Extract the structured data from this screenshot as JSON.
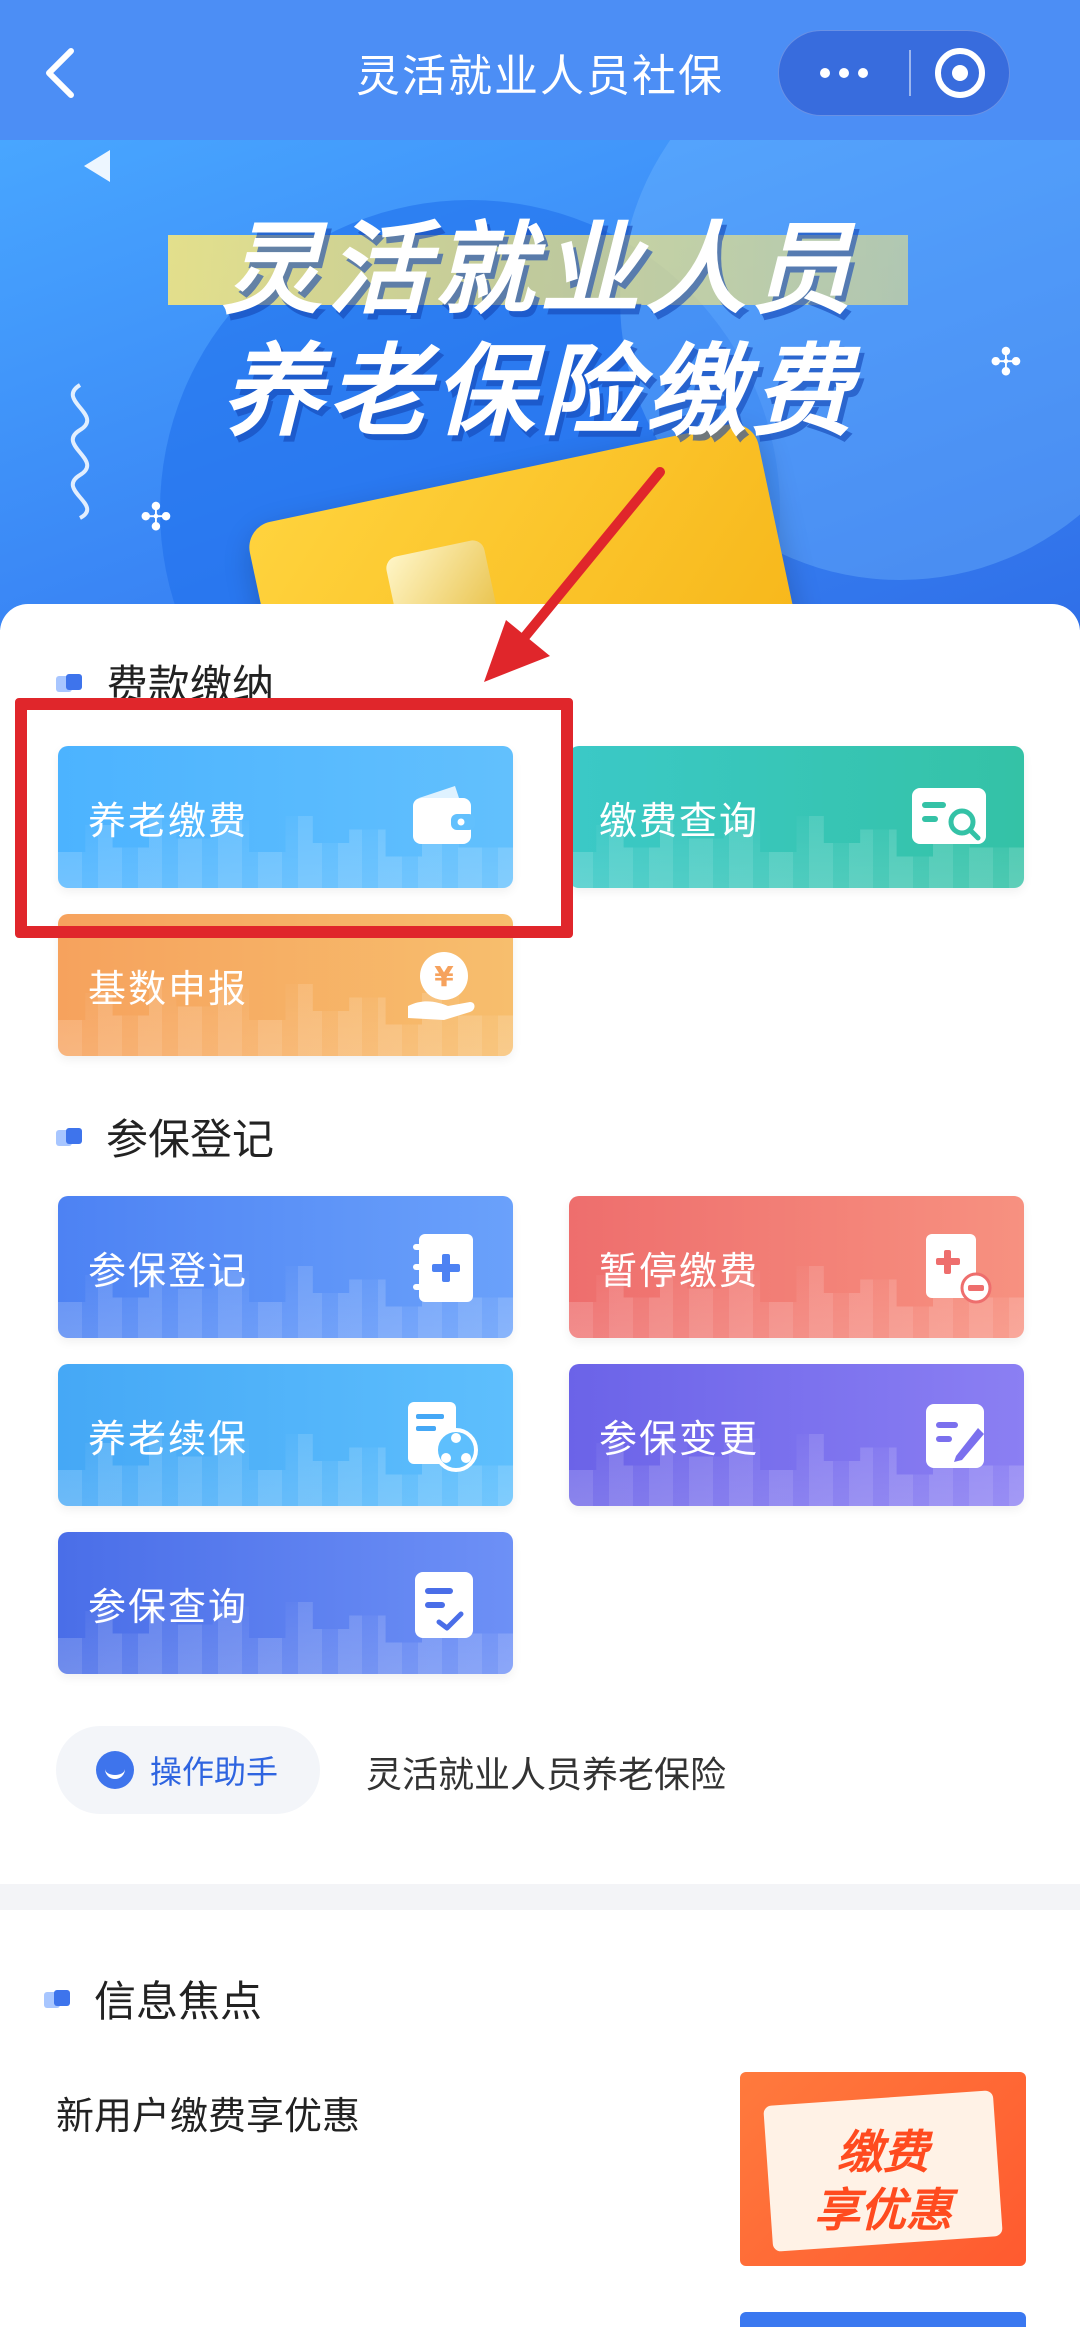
{
  "nav": {
    "title": "灵活就业人员社保"
  },
  "banner": {
    "line1": "灵活就业人员",
    "line2": "养老保险缴费"
  },
  "sections": {
    "payment": {
      "title": "费款缴纳",
      "tiles": [
        {
          "label": "养老缴费",
          "icon": "wallet-icon"
        },
        {
          "label": "缴费查询",
          "icon": "search-card-icon"
        },
        {
          "label": "基数申报",
          "icon": "yuan-hand-icon"
        }
      ]
    },
    "registration": {
      "title": "参保登记",
      "tiles": [
        {
          "label": "参保登记",
          "icon": "notebook-plus-icon"
        },
        {
          "label": "暂停缴费",
          "icon": "doc-minus-icon"
        },
        {
          "label": "养老续保",
          "icon": "share-doc-icon"
        },
        {
          "label": "参保变更",
          "icon": "edit-doc-icon"
        },
        {
          "label": "参保查询",
          "icon": "check-doc-icon"
        }
      ]
    }
  },
  "assistant": {
    "label": "操作助手",
    "note": "灵活就业人员养老保险"
  },
  "news": {
    "title": "信息焦点",
    "items": [
      {
        "text": "新用户缴费享优惠",
        "promo_line1": "缴费",
        "promo_line2": "享优惠"
      }
    ]
  },
  "colors": {
    "nav": "#4c8ef5",
    "highlight": "#e0262b",
    "accent": "#3e74ec"
  }
}
